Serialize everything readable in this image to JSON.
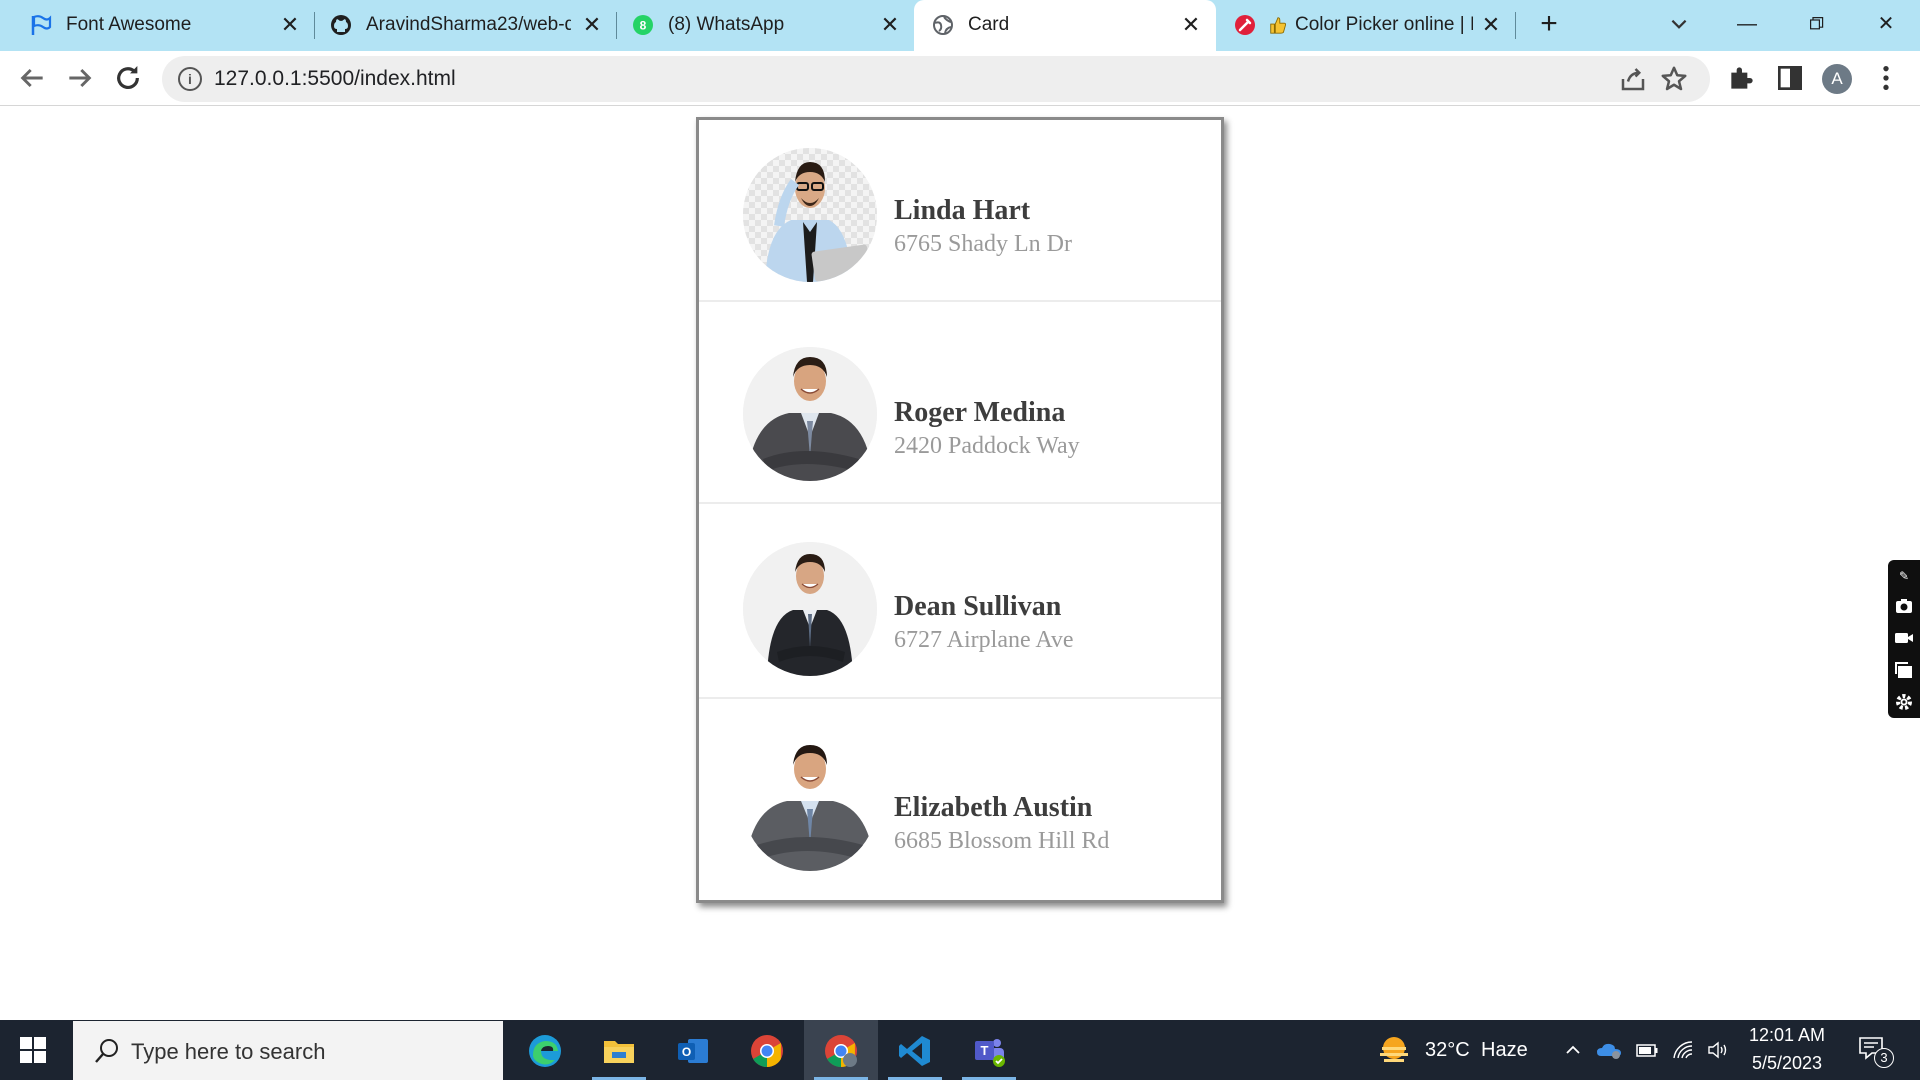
{
  "browser": {
    "tabs": [
      {
        "title": "Font Awesome",
        "icon": "flag-icon"
      },
      {
        "title": "AravindSharma23/web-de",
        "icon": "github-icon"
      },
      {
        "title": "(8) WhatsApp",
        "icon": "whatsapp-icon"
      },
      {
        "title": "Card",
        "icon": "globe-icon",
        "active": true
      },
      {
        "title": "Color Picker online | H",
        "icon": "color-picker-icon"
      }
    ],
    "url": "127.0.0.1:5500/index.html",
    "profile_initial": "A"
  },
  "people": [
    {
      "name": "Linda Hart",
      "address": "6765 Shady Ln Dr"
    },
    {
      "name": "Roger Medina",
      "address": "2420 Paddock Way"
    },
    {
      "name": "Dean Sullivan",
      "address": "6727 Airplane Ave"
    },
    {
      "name": "Elizabeth Austin",
      "address": "6685 Blossom Hill Rd"
    }
  ],
  "taskbar": {
    "search_placeholder": "Type here to search",
    "weather_temp": "32°C",
    "weather_desc": "Haze",
    "time": "12:01 AM",
    "date": "5/5/2023",
    "notification_count": "3"
  },
  "colors": {
    "tabstrip": "#b3e3f4",
    "taskbar": "#1c2430",
    "name_text": "#3d3d3d",
    "address_text": "#9a9a9a"
  }
}
